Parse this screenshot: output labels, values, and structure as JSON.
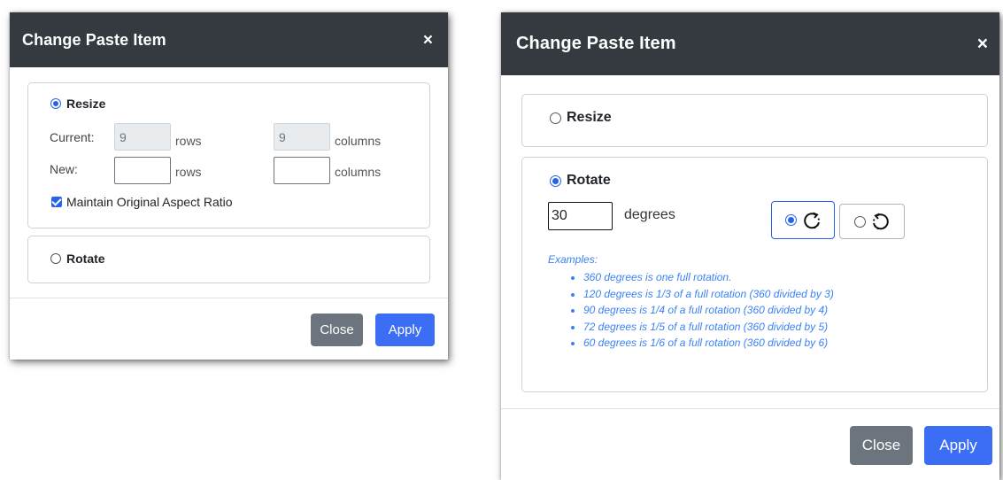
{
  "dialog_left": {
    "title": "Change Paste Item",
    "close_icon": "×",
    "resize_label": "Resize",
    "current_label": "Current:",
    "current_rows": "9",
    "rows_unit": "rows",
    "current_columns": "9",
    "columns_unit": "columns",
    "new_label": "New:",
    "new_rows": "",
    "new_columns": "",
    "maintain_label": "Maintain Original Aspect Ratio",
    "rotate_label": "Rotate",
    "close_button": "Close",
    "apply_button": "Apply"
  },
  "dialog_right": {
    "title": "Change Paste Item",
    "close_icon": "×",
    "resize_label": "Resize",
    "rotate_label": "Rotate",
    "degrees_value": "30",
    "degrees_unit": "degrees",
    "examples_title": "Examples:",
    "examples": [
      "360 degrees is one full rotation.",
      "120 degrees is 1/3 of a full rotation (360 divided by 3)",
      "90 degrees is 1/4 of a full rotation (360 divided by 4)",
      "72 degrees is 1/5 of a full rotation (360 divided by 5)",
      "60 degrees is 1/6 of a full rotation (360 divided by 6)"
    ],
    "close_button": "Close",
    "apply_button": "Apply"
  },
  "colors": {
    "header_bg": "#343a40",
    "accent": "#2563eb",
    "apply_bg": "#3b6ef5",
    "close_bg": "#6c757d",
    "example_text": "#3b82f6"
  },
  "icons": [
    "close-icon",
    "radio-selected-icon",
    "radio-unselected-icon",
    "checkbox-checked-icon",
    "rotate-clockwise-icon",
    "rotate-counterclockwise-icon"
  ]
}
